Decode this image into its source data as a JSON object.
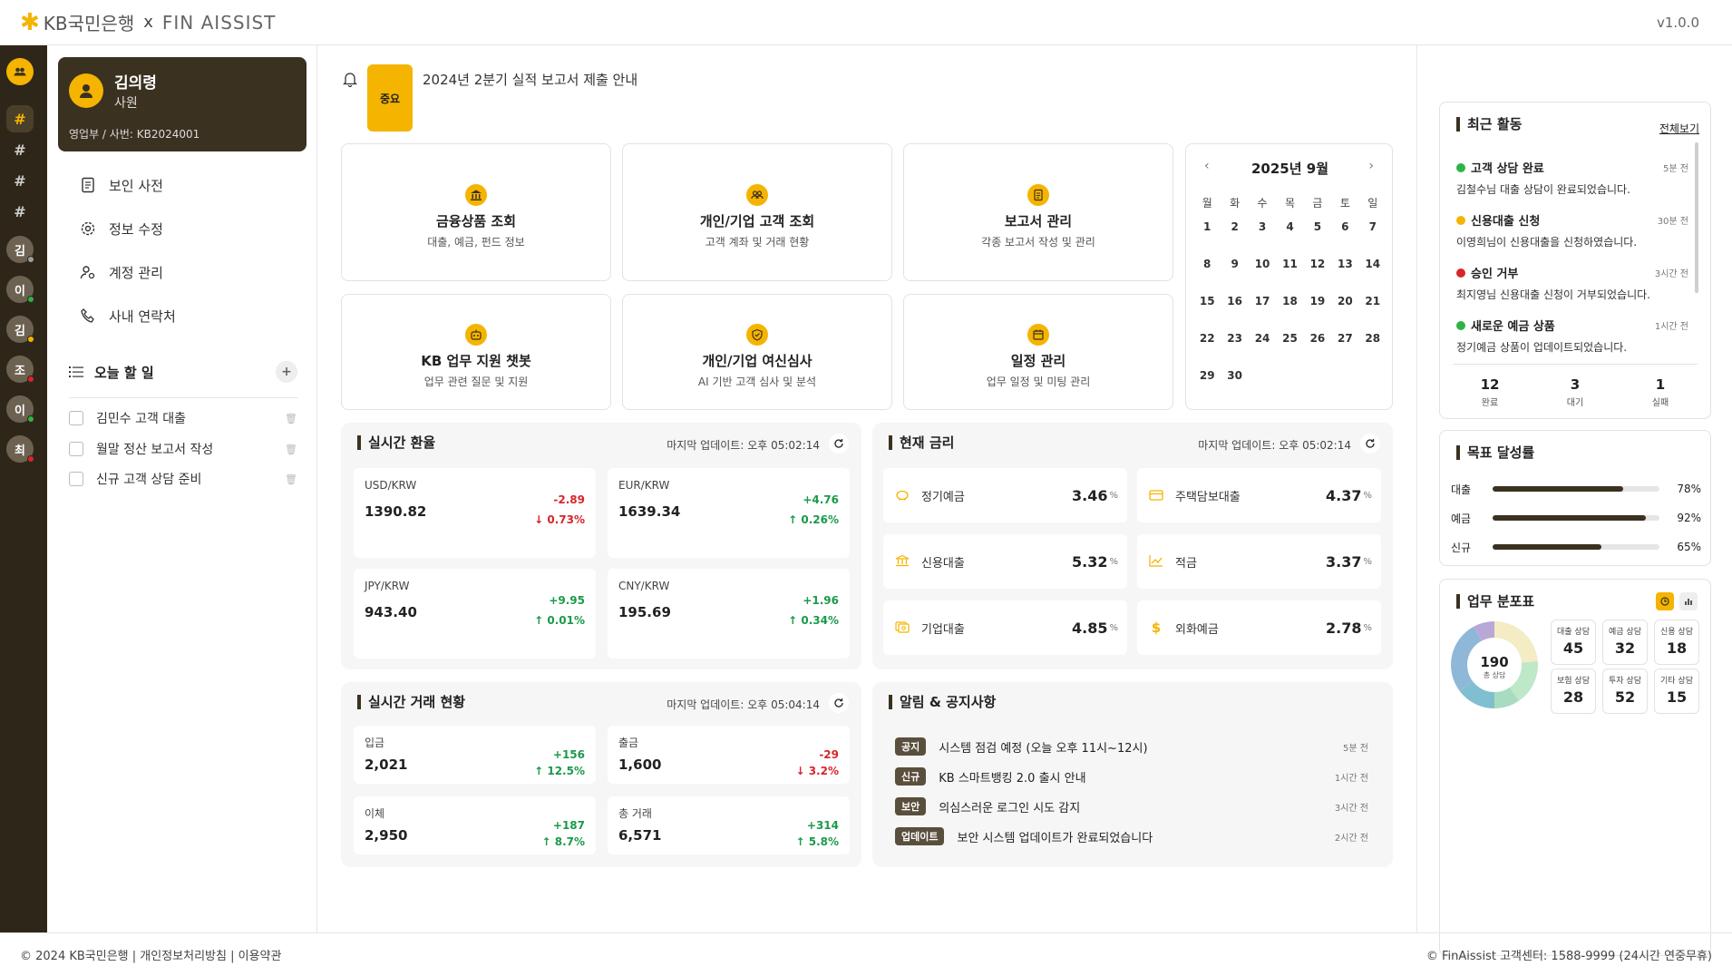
{
  "header": {
    "brand": "KB국민은행",
    "x": "x",
    "product": "FIN AISSIST",
    "version": "v1.0.0"
  },
  "rail": {
    "channels": [
      "#",
      "#",
      "#",
      "#"
    ],
    "users": [
      {
        "initial": "김",
        "status_color": "#9e9e9e"
      },
      {
        "initial": "이",
        "status_color": "#2fb344"
      },
      {
        "initial": "김",
        "status_color": "#f5b400"
      },
      {
        "initial": "조",
        "status_color": "#d7252c"
      },
      {
        "initial": "이",
        "status_color": "#2fb344"
      },
      {
        "initial": "최",
        "status_color": "#d7252c"
      }
    ]
  },
  "profile": {
    "name": "김의령",
    "role": "사원",
    "dept": "영업부 / 사번: KB2024001"
  },
  "menu": [
    {
      "label": "보인 사전",
      "icon": "document-icon"
    },
    {
      "label": "정보 수정",
      "icon": "gear-icon"
    },
    {
      "label": "계정 관리",
      "icon": "user-gear-icon"
    },
    {
      "label": "사내 연락처",
      "icon": "phone-icon"
    }
  ],
  "todo": {
    "title": "오늘 할 일",
    "add": "+",
    "items": [
      "김민수 고객 대출",
      "월말 정산 보고서 작성",
      "신규 고객 상담 준비"
    ]
  },
  "notice": {
    "badge": "중요",
    "text": "2024년 2분기 실적 보고서 제출 안내"
  },
  "quick": [
    {
      "title": "금융상품 조회",
      "sub": "대출, 예금, 펀드 정보",
      "icon": "bank-icon"
    },
    {
      "title": "개인/기업 고객 조회",
      "sub": "고객 계좌 및 거래 현황",
      "icon": "users-icon"
    },
    {
      "title": "보고서 관리",
      "sub": "각종 보고서 작성 및 관리",
      "icon": "report-icon"
    },
    {
      "title": "KB 업무 지원 챗봇",
      "sub": "업무 관련 질문 및 지원",
      "icon": "bot-icon"
    },
    {
      "title": "개인/기업 여신심사",
      "sub": "AI 기반 고객 심사 및 분석",
      "icon": "shield-icon"
    },
    {
      "title": "일정 관리",
      "sub": "업무 일정 및 미팅 관리",
      "icon": "calendar-icon"
    }
  ],
  "calendar": {
    "title": "2025년 9월",
    "prev": "‹",
    "next": "›",
    "dow": [
      "월",
      "화",
      "수",
      "목",
      "금",
      "토",
      "일"
    ],
    "days": [
      "1",
      "2",
      "3",
      "4",
      "5",
      "6",
      "7",
      "8",
      "9",
      "10",
      "11",
      "12",
      "13",
      "14",
      "15",
      "16",
      "17",
      "18",
      "19",
      "20",
      "21",
      "22",
      "23",
      "24",
      "25",
      "26",
      "27",
      "28",
      "29",
      "30"
    ]
  },
  "fx": {
    "title": "실시간 환율",
    "updated": "마지막 업데이트: 오후 05:02:14",
    "items": [
      {
        "pair": "USD/KRW",
        "rate": "1390.82",
        "change": "-2.89",
        "pct": "↓ 0.73%",
        "dir": "down"
      },
      {
        "pair": "EUR/KRW",
        "rate": "1639.34",
        "change": "+4.76",
        "pct": "↑ 0.26%",
        "dir": "up"
      },
      {
        "pair": "JPY/KRW",
        "rate": "943.40",
        "change": "+9.95",
        "pct": "↑ 0.01%",
        "dir": "up"
      },
      {
        "pair": "CNY/KRW",
        "rate": "195.69",
        "change": "+1.96",
        "pct": "↑ 0.34%",
        "dir": "up"
      }
    ]
  },
  "rates": {
    "title": "현재 금리",
    "updated": "마지막 업데이트: 오후 05:02:14",
    "items": [
      {
        "name": "정기예금",
        "value": "3.46",
        "unit": "%",
        "icon": "piggy-icon"
      },
      {
        "name": "주택담보대출",
        "value": "4.37",
        "unit": "%",
        "icon": "card-icon"
      },
      {
        "name": "신용대출",
        "value": "5.32",
        "unit": "%",
        "icon": "bank-icon"
      },
      {
        "name": "적금",
        "value": "3.37",
        "unit": "%",
        "icon": "chart-line-icon"
      },
      {
        "name": "기업대출",
        "value": "4.85",
        "unit": "%",
        "icon": "cash-icon"
      },
      {
        "name": "외화예금",
        "value": "2.78",
        "unit": "%",
        "icon": "dollar-icon"
      }
    ]
  },
  "tx": {
    "title": "실시간 거래 현황",
    "updated": "마지막 업데이트: 오후 05:04:14",
    "items": [
      {
        "label": "입금",
        "value": "2,021",
        "change": "+156",
        "pct": "↑ 12.5%",
        "dir": "up"
      },
      {
        "label": "출금",
        "value": "1,600",
        "change": "-29",
        "pct": "↓ 3.2%",
        "dir": "down"
      },
      {
        "label": "이체",
        "value": "2,950",
        "change": "+187",
        "pct": "↑ 8.7%",
        "dir": "up"
      },
      {
        "label": "총 거래",
        "value": "6,571",
        "change": "+314",
        "pct": "↑ 5.8%",
        "dir": "up"
      }
    ]
  },
  "alerts": {
    "title": "알림 & 공지사항",
    "items": [
      {
        "tag": "공지",
        "text": "시스템 점검 예정 (오늘 오후 11시~12시)",
        "time": "5분 전"
      },
      {
        "tag": "신규",
        "text": "KB 스마트뱅킹 2.0 출시 안내",
        "time": "1시간 전"
      },
      {
        "tag": "보안",
        "text": "의심스러운 로그인 시도 감지",
        "time": "3시간 전"
      },
      {
        "tag": "업데이트",
        "text": "보안 시스템 업데이트가 완료되었습니다",
        "time": "2시간 전"
      }
    ]
  },
  "activity": {
    "title": "최근 활동",
    "view_all": "전체보기",
    "items": [
      {
        "title": "고객 상담 완료",
        "time": "5분 전",
        "desc": "김철수님 대출 상담이 완료되었습니다.",
        "color": "#2fb344"
      },
      {
        "title": "신용대출 신청",
        "time": "30분 전",
        "desc": "이영희님이 신용대출을 신청하였습니다.",
        "color": "#f5b400"
      },
      {
        "title": "승인 거부",
        "time": "3시간 전",
        "desc": "최지영님 신용대출 신청이 거부되었습니다.",
        "color": "#d7252c"
      },
      {
        "title": "새로운 예금 상품",
        "time": "1시간 전",
        "desc": "정기예금 상품이 업데이트되었습니다.",
        "color": "#2fb344"
      }
    ],
    "stats": [
      {
        "value": "12",
        "label": "완료"
      },
      {
        "value": "3",
        "label": "대기"
      },
      {
        "value": "1",
        "label": "실패"
      }
    ]
  },
  "goals": {
    "title": "목표 달성률",
    "items": [
      {
        "label": "대출",
        "pct_text": "78%",
        "value": 78
      },
      {
        "label": "예금",
        "pct_text": "92%",
        "value": 92
      },
      {
        "label": "신규",
        "pct_text": "65%",
        "value": 65
      }
    ]
  },
  "distribution": {
    "title": "업무 분포표",
    "total": "190",
    "total_label": "총 상담",
    "items": [
      {
        "label": "대출 상담",
        "value": "45",
        "color": "#f3ecc4"
      },
      {
        "label": "예금 상담",
        "value": "32",
        "color": "#bfe8c8"
      },
      {
        "label": "신용 상담",
        "value": "18",
        "color": "#a8dcc0"
      },
      {
        "label": "보험 상담",
        "value": "28",
        "color": "#80bfd0"
      },
      {
        "label": "투자 상담",
        "value": "52",
        "color": "#8fb8d8"
      },
      {
        "label": "기타 상담",
        "value": "15",
        "color": "#b8a8d8"
      }
    ]
  },
  "footer": {
    "left": "© 2024 KB국민은행 | 개인정보처리방침 | 이용약관",
    "right": "© FinAissist 고객센터: 1588-9999 (24시간 연중무휴)"
  }
}
